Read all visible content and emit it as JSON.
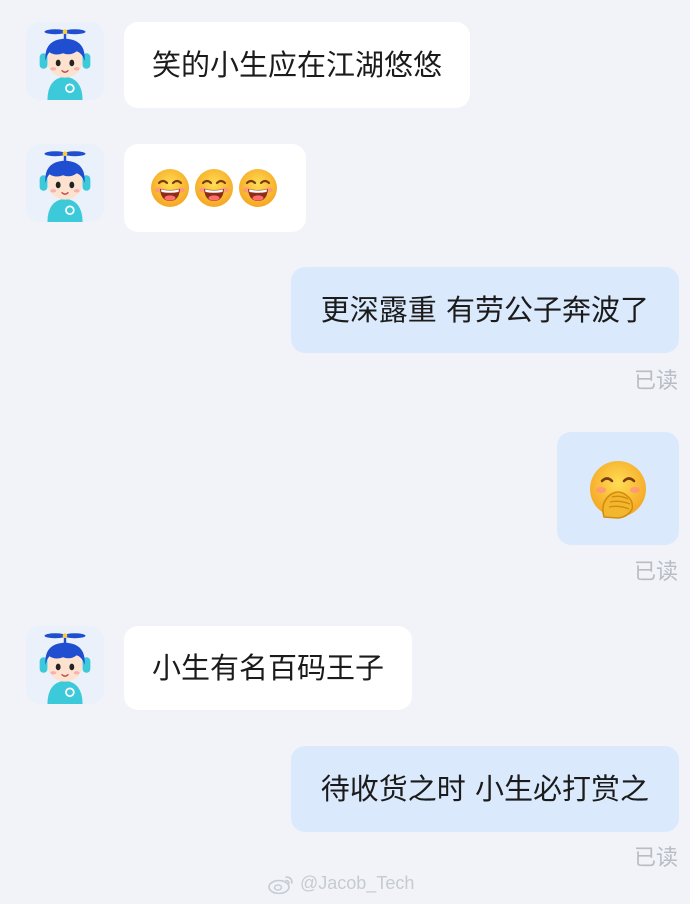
{
  "conversation": {
    "messages": [
      {
        "direction": "in",
        "text": "笑的小生应在江湖悠悠"
      },
      {
        "direction": "in",
        "emoji": [
          "grinning-squint-emoji",
          "grinning-squint-emoji",
          "grinning-squint-emoji"
        ]
      },
      {
        "direction": "out",
        "text": "更深露重 有劳公子奔波了",
        "status": "已读"
      },
      {
        "direction": "out",
        "emoji": [
          "hand-over-mouth-emoji"
        ],
        "status": "已读"
      },
      {
        "direction": "in",
        "text": "小生有名百码王子"
      },
      {
        "direction": "out",
        "text": "待收货之时 小生必打赏之",
        "status": "已读"
      }
    ]
  },
  "watermark": {
    "text": "@Jacob_Tech",
    "icon": "weibo-icon"
  },
  "colors": {
    "background": "#f1f3f8",
    "incoming_bubble": "#ffffff",
    "outgoing_bubble": "#dbe9fc",
    "read_status": "#b8bcc4",
    "avatar_blue": "#1f4fd0",
    "avatar_teal": "#3cc9d9"
  }
}
